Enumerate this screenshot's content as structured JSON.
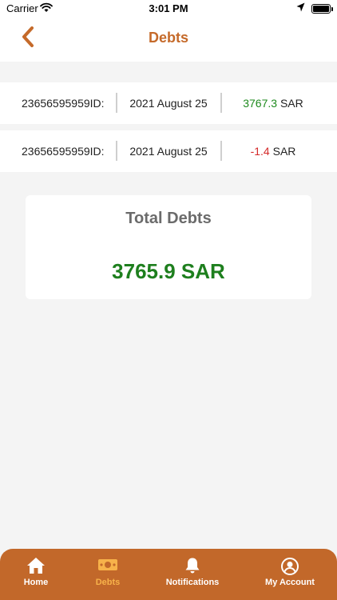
{
  "status_bar": {
    "carrier": "Carrier",
    "time": "3:01 PM"
  },
  "header": {
    "title": "Debts",
    "back_icon": "chevron-left-icon",
    "accent_color": "#c56a2a"
  },
  "debts": [
    {
      "id": "23656595959ID:",
      "date": "2021 August 25",
      "amount": "3767.3",
      "currency": "SAR",
      "amount_color": "#1e8a1e"
    },
    {
      "id": "23656595959ID:",
      "date": "2021 August 25",
      "amount": "-1.4",
      "currency": "SAR",
      "amount_color": "#d42a2a"
    }
  ],
  "total": {
    "title": "Total Debts",
    "value": "3765.9 SAR",
    "color": "#1e7f1e"
  },
  "tabs": [
    {
      "label": "Home",
      "icon": "home-icon",
      "active": false
    },
    {
      "label": "Debts",
      "icon": "money-icon",
      "active": true
    },
    {
      "label": "Notifications",
      "icon": "bell-icon",
      "active": false
    },
    {
      "label": "My Account",
      "icon": "user-circle-icon",
      "active": false
    }
  ],
  "tab_bar_color": "#c2682a",
  "tab_active_color": "#f7b24a"
}
